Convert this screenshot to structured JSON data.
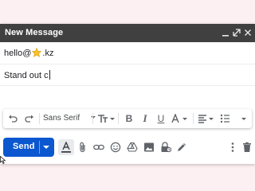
{
  "window": {
    "title": "New Message"
  },
  "title_controls": [
    "minimize-icon",
    "pop-out-icon",
    "close-icon"
  ],
  "to": {
    "prefix": "hello@",
    "suffix": ".kz",
    "icon": "star-emoji-icon"
  },
  "subject": {
    "value": "Stand out c"
  },
  "format_toolbar": {
    "font_family": "Sans Serif",
    "icons": [
      "undo-icon",
      "redo-icon",
      "font-size-icon",
      "bold-icon",
      "italic-icon",
      "underline-icon",
      "text-color-icon",
      "align-icon",
      "bulleted-list-icon",
      "more-formatting-icon"
    ]
  },
  "bottom_bar": {
    "send_label": "Send",
    "icons": [
      "formatting-options-icon",
      "attach-icon",
      "link-icon",
      "emoji-icon",
      "drive-icon",
      "photo-icon",
      "confidential-mode-icon",
      "signature-icon",
      "more-options-icon",
      "discard-icon"
    ]
  },
  "colors": {
    "titlebar": "#404040",
    "send": "#0b57d0",
    "background": "#fdf0f2"
  }
}
